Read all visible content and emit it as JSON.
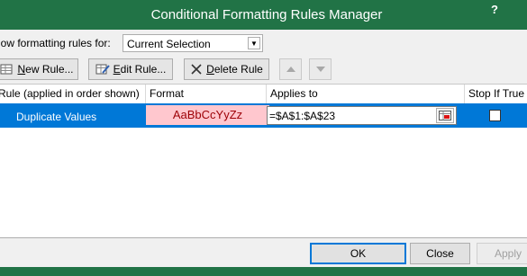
{
  "window": {
    "title": "Conditional Formatting Rules Manager",
    "help_label": "?"
  },
  "scope": {
    "label": "how formatting rules for:",
    "selected": "Current Selection"
  },
  "toolbar": {
    "new_rule": {
      "accel": "N",
      "rest": "ew Rule..."
    },
    "edit_rule": {
      "accel": "E",
      "rest": "dit Rule..."
    },
    "delete_rule": {
      "accel": "D",
      "rest": "elete Rule"
    }
  },
  "table": {
    "headers": {
      "rule": "Rule (applied in order shown)",
      "format": "Format",
      "applies_to": "Applies to",
      "stop_if_true": "Stop If True"
    },
    "rows": [
      {
        "rule": "Duplicate Values",
        "format_preview": "AaBbCcYyZz",
        "applies_to": "=$A$1:$A$23",
        "stop_if_true": false
      }
    ]
  },
  "buttons": {
    "ok": "OK",
    "close": "Close",
    "apply": "Apply"
  },
  "colors": {
    "title_bar": "#217346",
    "selection": "#0078d7",
    "format_fill": "#ffc7ce",
    "format_text": "#9c0006"
  }
}
